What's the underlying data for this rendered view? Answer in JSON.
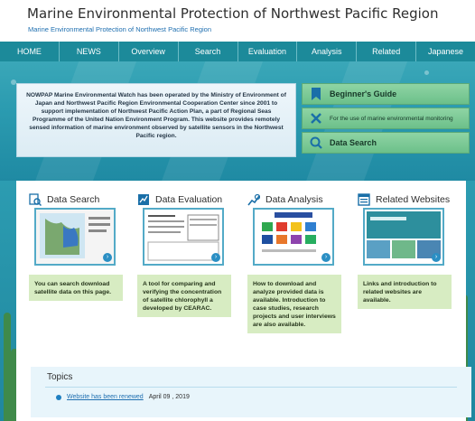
{
  "header": {
    "title": "Marine Environmental Protection of Northwest Pacific Region",
    "subtitle": "Marine Environmental Protection of Northwest Pacific Region"
  },
  "nav": [
    "HOME",
    "NEWS",
    "Overview",
    "Search",
    "Evaluation",
    "Analysis",
    "Related",
    "Japanese"
  ],
  "intro": {
    "text": "NOWPAP Marine Environmental Watch has been operated by the Ministry of Environment of Japan and Northwest Pacific Region Environmental Cooperation Center since 2001 to support implementation of Northwest Pacific Action Plan, a part of Regional Seas Programme of the United Nation Environment Program. This website provides remotely sensed information of marine environment observed by satellite sensors in the Northwest Pacific region."
  },
  "side_buttons": [
    {
      "label": "Beginner's Guide",
      "icon": "bookmark-icon"
    },
    {
      "label": "For the use of marine environmental monitoring",
      "icon": "tools-icon"
    },
    {
      "label": "Data Search",
      "icon": "search-icon"
    }
  ],
  "columns": [
    {
      "title": "Data Search",
      "icon": "magnifier-doc-icon",
      "desc": "You can search download satellite data on this page."
    },
    {
      "title": "Data Evaluation",
      "icon": "chart-icon",
      "desc": "A tool for comparing and verifying the concentration of satellite chlorophyll a developed by CEARAC."
    },
    {
      "title": "Data Analysis",
      "icon": "analysis-icon",
      "desc": "How to download and analyze provided data is available. Introduction to case studies, research projects and user interviews are also available."
    },
    {
      "title": "Related Websites",
      "icon": "window-icon",
      "desc": "Links and introduction to related websites are available."
    }
  ],
  "topics": {
    "title": "Topics",
    "items": [
      {
        "link": "Website has been renewed",
        "date": "April 09 , 2019"
      }
    ]
  },
  "colors": {
    "nav": "#1c8a9a",
    "accent_green": "#8fd4a4",
    "desc_bg": "#d7ecc2",
    "link": "#1f6fb0"
  }
}
